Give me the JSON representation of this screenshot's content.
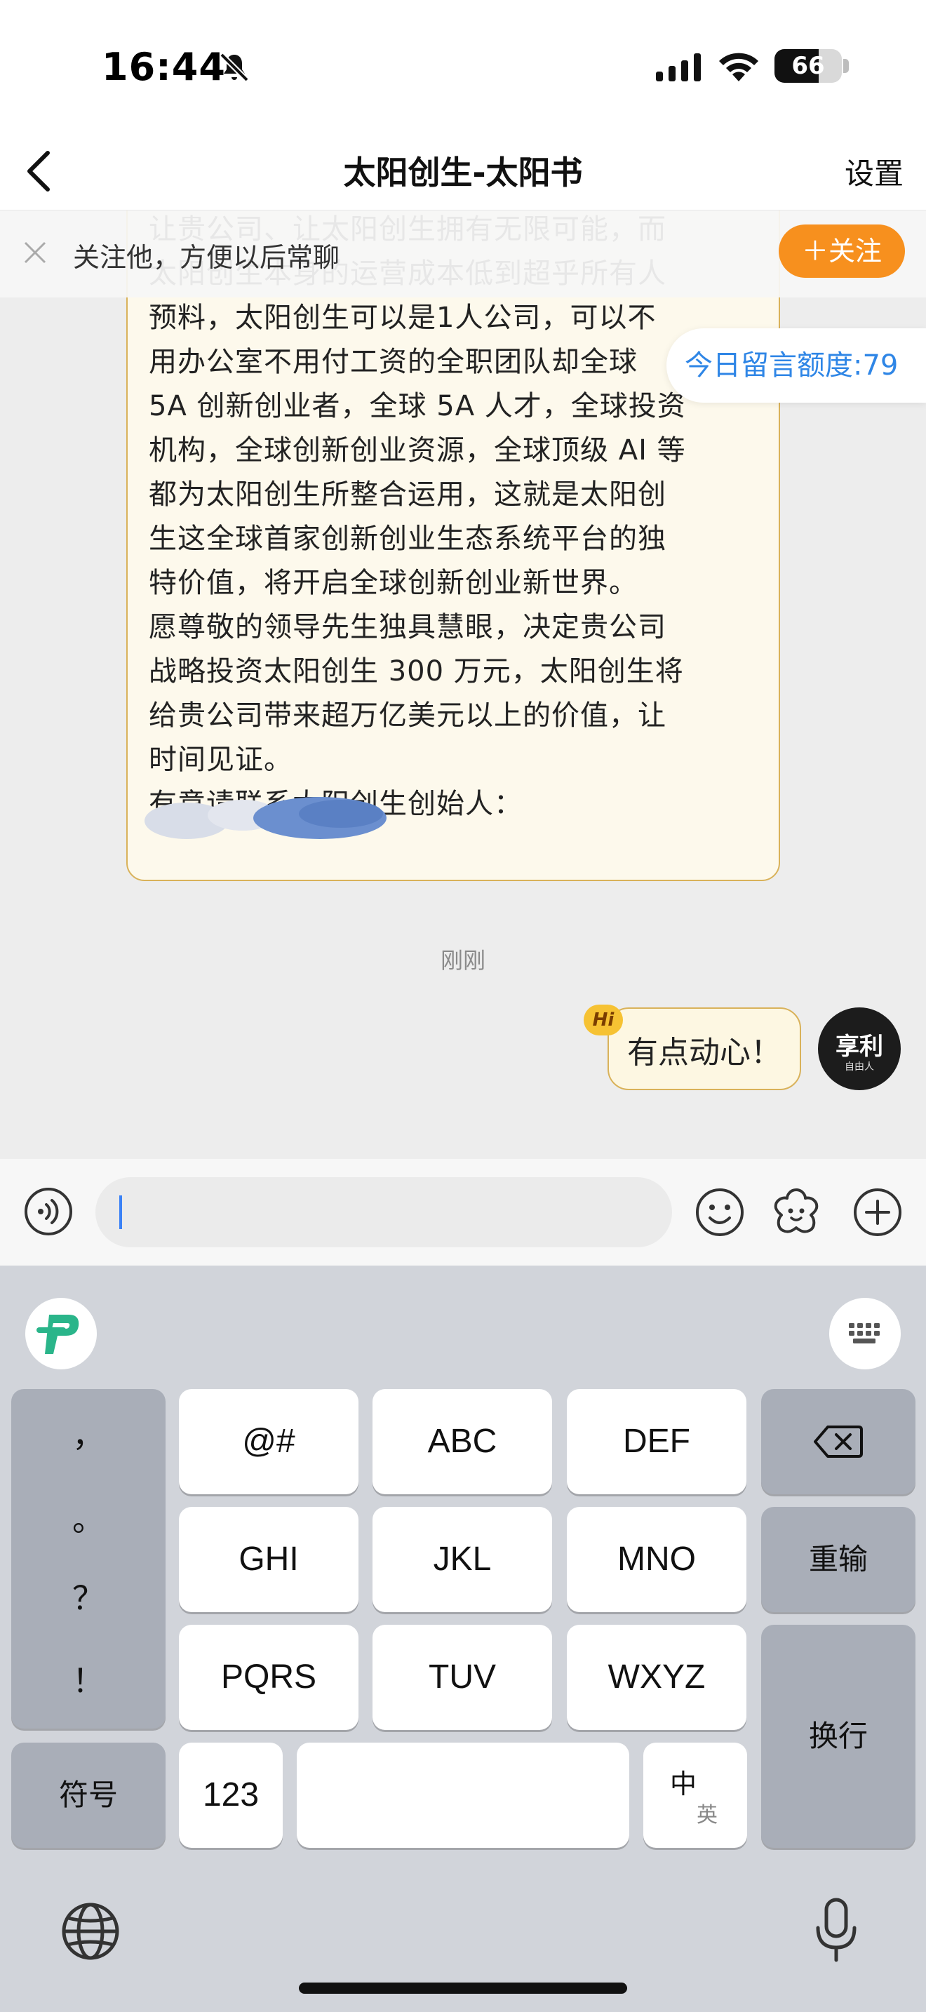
{
  "status_bar": {
    "time": "16:44",
    "battery": 66
  },
  "nav": {
    "title": "太阳创生-太阳书",
    "settings": "设置"
  },
  "follow_bar": {
    "text": "关注他，方便以后常聊",
    "button": "＋关注"
  },
  "quota": {
    "text": "今日留言额度:79"
  },
  "message": {
    "lines": [
      "让贵公司、让太阳创生拥有无限可能，而",
      "太阳创生本身的运营成本低到超乎所有人",
      "预料，太阳创生可以是1人公司，可以不",
      "用办公室不用付工资的全职团队却全球",
      "5A 创新创业者，全球 5A 人才，全球投资",
      "机构，全球创新创业资源，全球顶级 AI 等",
      "都为太阳创生所整合运用，这就是太阳创",
      "生这全球首家创新创业生态系统平台的独",
      "特价值，将开启全球创新创业新世界。",
      "愿尊敬的领导先生独具慧眼，决定贵公司",
      "战略投资太阳创生 300 万元，太阳创生将",
      "给贵公司带来超万亿美元以上的价值，让",
      "时间见证。",
      "有意请联系太阳创生创始人："
    ]
  },
  "timestamp": "刚刚",
  "my_message": {
    "text": "有点动心！",
    "badge": "Hi"
  },
  "avatar": {
    "logo": "享利",
    "sub": "自由人"
  },
  "keyboard": {
    "punct": [
      "，",
      "。",
      "？",
      "！"
    ],
    "row1": [
      "@#",
      "ABC",
      "DEF"
    ],
    "row2": [
      "GHI",
      "JKL",
      "MNO"
    ],
    "row3": [
      "PQRS",
      "TUV",
      "WXYZ"
    ],
    "symbols": "符号",
    "num": "123",
    "lang_top": "中",
    "lang_bottom": "英",
    "retype": "重输",
    "newline": "换行"
  },
  "colors": {
    "accent_orange": "#f7901e",
    "quota_blue": "#2f86e6",
    "bubble_border": "#d9b25a",
    "bubble_bg": "#fdf9ec"
  },
  "icons": [
    "silent-bell-icon",
    "signal-icon",
    "wifi-icon",
    "battery-icon",
    "back-chevron-icon",
    "close-icon",
    "voice-icon",
    "emoji-icon",
    "sticker-icon",
    "plus-icon",
    "keyboard-logo-icon",
    "keyboard-hide-icon",
    "backspace-icon",
    "globe-icon",
    "mic-icon"
  ]
}
